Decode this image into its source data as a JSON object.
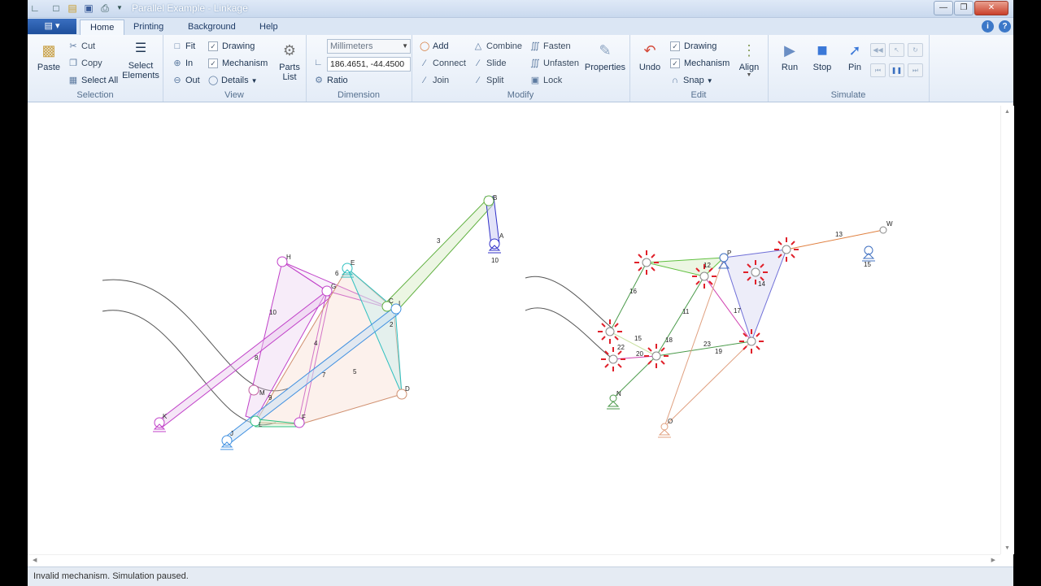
{
  "window": {
    "title": "Parallel Example - Linkage"
  },
  "tabs": [
    {
      "label": "Home",
      "active": true
    },
    {
      "label": "Printing",
      "active": false
    },
    {
      "label": "Background",
      "active": false
    },
    {
      "label": "Help",
      "active": false
    }
  ],
  "ribbon": {
    "selection": {
      "paste": "Paste",
      "cut": "Cut",
      "copy": "Copy",
      "select_all": "Select All",
      "select_elements": "Select Elements",
      "label": "Selection"
    },
    "view": {
      "fit": "Fit",
      "in": "In",
      "out": "Out",
      "drawing": "Drawing",
      "mechanism": "Mechanism",
      "details": "Details",
      "parts_list": "Parts List",
      "label": "View"
    },
    "dimension": {
      "units": "Millimeters",
      "coordinates": "186.4651, -44.4500",
      "ratio": "Ratio",
      "label": "Dimension"
    },
    "modify": {
      "add": "Add",
      "connect": "Connect",
      "join": "Join",
      "combine": "Combine",
      "slide": "Slide",
      "split": "Split",
      "fasten": "Fasten",
      "unfasten": "Unfasten",
      "lock": "Lock",
      "properties": "Properties",
      "label": "Modify"
    },
    "edit": {
      "undo": "Undo",
      "drawing": "Drawing",
      "mechanism": "Mechanism",
      "snap": "Snap",
      "align": "Align",
      "label": "Edit"
    },
    "simulate": {
      "run": "Run",
      "stop": "Stop",
      "pin": "Pin",
      "label": "Simulate"
    }
  },
  "canvas": {
    "left_mechanism": {
      "joint_labels": [
        "H",
        "E",
        "G",
        "C",
        "I",
        "B",
        "A",
        "10",
        "K",
        "M",
        "L",
        "J",
        "F",
        "D"
      ],
      "link_labels": [
        "6",
        "10",
        "8",
        "4",
        "7",
        "5",
        "2",
        "3",
        "9"
      ]
    },
    "right_mechanism": {
      "joint_labels": [
        "P",
        "W",
        "N",
        "O"
      ],
      "link_labels": [
        "12",
        "13",
        "14",
        "16",
        "11",
        "17",
        "15",
        "18",
        "22",
        "20",
        "23",
        "19",
        "15"
      ]
    }
  },
  "status": {
    "message": "Invalid mechanism. Simulation paused."
  },
  "colors": {
    "accent": "#1e4f9c",
    "ribbon_bg": "#e4ecf7",
    "error_marker": "#e0202a"
  }
}
